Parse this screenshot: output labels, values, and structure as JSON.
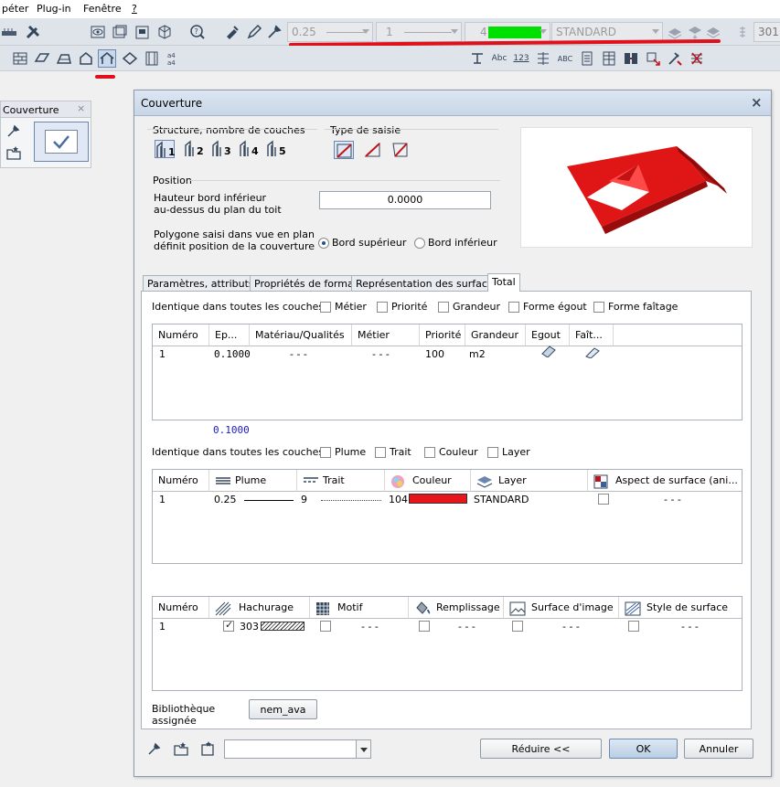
{
  "menu": [
    "péter",
    "Plug-in",
    "Fenêtre",
    "?"
  ],
  "toolbar": {
    "pen_value": "0.25",
    "line_value": "1",
    "color_value": "4",
    "color_swatch": "#00e000",
    "layer_value": "STANDARD",
    "scale_value": "301"
  },
  "panel": {
    "title": "Couverture"
  },
  "dialog": {
    "title": "Couverture",
    "structure_label": "Structure, nombre de couches",
    "layer_counts": [
      "1",
      "2",
      "3",
      "4",
      "5"
    ],
    "type_label": "Type de saisie",
    "position_label": "Position",
    "hauteur_label1": "Hauteur bord inférieur",
    "hauteur_label2": "au-dessus du plan du toit",
    "hauteur_value": "0.0000",
    "polygone_label1": "Polygone saisi dans vue en plan",
    "polygone_label2": "définit position de la couverture",
    "radio_upper": "Bord supérieur",
    "radio_lower": "Bord inférieur",
    "tabs": [
      "Paramètres, attributs",
      "Propriétés de format",
      "Représentation des surfaces",
      "Total"
    ],
    "identique_label": "Identique dans toutes les couches :",
    "identique1": [
      "Métier",
      "Priorité",
      "Grandeur",
      "Forme égout",
      "Forme faîtage"
    ],
    "table1": {
      "headers": [
        "Numéro",
        "Ep...",
        "Matériau/Qualités",
        "Métier",
        "Priorité",
        "Grandeur",
        "Egout",
        "Faît..."
      ],
      "row": [
        "1",
        "0.1000",
        "- - -",
        "- - -",
        "100",
        "m2"
      ],
      "total": "0.1000"
    },
    "identique2": [
      "Plume",
      "Trait",
      "Couleur",
      "Layer"
    ],
    "table2": {
      "headers": [
        "Numéro",
        "Plume",
        "Trait",
        "Couleur",
        "Layer",
        "Aspect de surface (ani..."
      ],
      "row": [
        "1",
        "0.25",
        "9",
        "104",
        "STANDARD",
        "- - -"
      ],
      "color": "#e8161b"
    },
    "table3": {
      "headers": [
        "Numéro",
        "Hachurage",
        "Motif",
        "Remplissage",
        "Surface d'image",
        "Style de surface"
      ],
      "row": [
        "1",
        "303",
        "- - -",
        "- - -",
        "- - -",
        "- - -"
      ]
    },
    "biblio_label1": "Bibliothèque",
    "biblio_label2": "assignée",
    "biblio_button": "nem_ava",
    "reduire_button": "Réduire <<",
    "ok_button": "OK",
    "annuler_button": "Annuler"
  },
  "colors": {
    "accent_red": "#e0111a",
    "roof": "#e01616"
  }
}
